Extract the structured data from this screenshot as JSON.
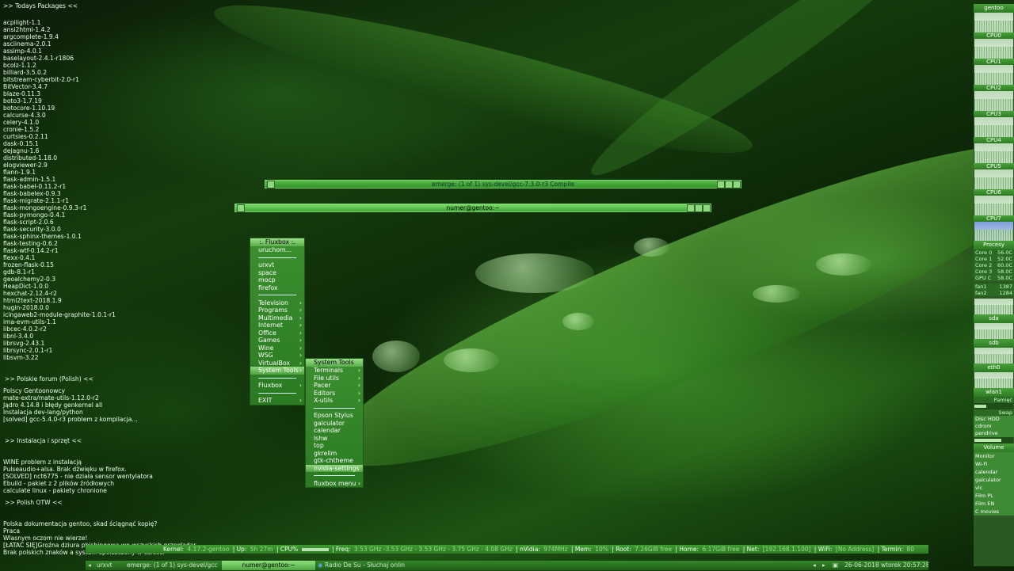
{
  "conky": {
    "packages_header": ">> Todays Packages <<",
    "packages": [
      "acpilight-1.1",
      "ansi2html-1.4.2",
      "argcomplete-1.9.4",
      "asciinema-2.0.1",
      "assimp-4.0.1",
      "baselayout-2.4.1-r1806",
      "bcolz-1.1.2",
      "billiard-3.5.0.2",
      "bitstream-cyberbit-2.0-r1",
      "BitVector-3.4.7",
      "blaze-0.11.3",
      "boto3-1.7.19",
      "botocore-1.10.19",
      "calcurse-4.3.0",
      "celery-4.1.0",
      "cronie-1.5.2",
      "curtsies-0.2.11",
      "dask-0.15.1",
      "dejagnu-1.6",
      "distributed-1.18.0",
      "elogviewer-2.9",
      "flann-1.9.1",
      "flask-admin-1.5.1",
      "flask-babel-0.11.2-r1",
      "flask-babelex-0.9.3",
      "flask-migrate-2.1.1-r1",
      "flask-mongoengine-0.9.3-r1",
      "flask-pymongo-0.4.1",
      "flask-script-2.0.6",
      "flask-security-3.0.0",
      "flask-sphinx-themes-1.0.1",
      "flask-testing-0.6.2",
      "flask-wtf-0.14.2-r1",
      "flexx-0.4.1",
      "frozen-flask-0.15",
      "gdb-8.1-r1",
      "geoalchemy2-0.3",
      "HeapDict-1.0.0",
      "hexchat-2.12.4-r2",
      "html2text-2018.1.9",
      "hugin-2018.0.0",
      "icingaweb2-module-graphite-1.0.1-r1",
      "ima-evm-utils-1.1",
      "libcec-4.0.2-r2",
      "libnl-3.4.0",
      "librsvg-2.43.1",
      "librsync-2.0.1-r1",
      "libsvm-3.22"
    ],
    "forum_header": ">> Polskie forum (Polish) <<",
    "forum": [
      "Polscy Gentoonowcy",
      "mate-extra/mate-utils-1.12.0-r2",
      "Jądro 4.14.8 i błędy genkernel all",
      "Instalacja dev-lang/python",
      "[solved] gcc-5.4.0-r3 problem z kompilacja..."
    ],
    "hw_header": ">> Instalacja i sprzęt <<",
    "hw": [
      "WINE problem z instalacją",
      "Pulseaudio+alsa. Brak dźwięku w firefox.",
      "[SOLVED] nct6775 - nie działa sensor wentylatora",
      "Ebuild - pakiet z 2 plików źródłowych",
      "calculate linux  - pakiety chronione"
    ],
    "otw_header": ">> Polish OTW <<",
    "otw": [
      "Polska dokumentacja gentoo, skad ściągnąć kopię?",
      "Praca",
      "Wlasnym oczom nie wierze!",
      "[ŁATAC SIĘ]Groźna dziura phishingowa we wszyskich przeglądar",
      "Brak polskich znaków a system spolszczony w całości"
    ]
  },
  "windows": {
    "emerge_title": "emerge: (1 of 1) sys-devel/gcc-7.3.0-r3 Compile",
    "terminal_title": "numer@gentoo:~"
  },
  "menu": {
    "title": ":. Fluxbox :.",
    "items": [
      {
        "label": "uruchom...",
        "sub": false
      },
      {
        "sep": true
      },
      {
        "label": "urxvt",
        "sub": false
      },
      {
        "label": "space",
        "sub": false
      },
      {
        "label": "mocp",
        "sub": false
      },
      {
        "label": "firefox",
        "sub": false
      },
      {
        "sep": true
      },
      {
        "label": "Television",
        "sub": true
      },
      {
        "label": "Programs",
        "sub": true
      },
      {
        "label": "Multimedia",
        "sub": true
      },
      {
        "label": "Internet",
        "sub": true
      },
      {
        "label": "Office",
        "sub": true
      },
      {
        "label": "Games",
        "sub": true
      },
      {
        "label": "Wine",
        "sub": true
      },
      {
        "label": "WSG",
        "sub": true
      },
      {
        "label": "VirtualBox",
        "sub": true
      },
      {
        "label": "System Tools",
        "sub": true,
        "active": true
      },
      {
        "sep": true
      },
      {
        "label": "Fluxbox",
        "sub": true
      },
      {
        "sep": true
      },
      {
        "label": "EXIT",
        "sub": true
      }
    ]
  },
  "submenu": {
    "title": "System Tools",
    "items": [
      {
        "label": "Terminals",
        "sub": true
      },
      {
        "label": "File utils",
        "sub": true
      },
      {
        "label": "Pacer",
        "sub": true
      },
      {
        "label": "Editors",
        "sub": true
      },
      {
        "label": "X-utils",
        "sub": true
      },
      {
        "sep": true
      },
      {
        "label": "Epson Stylus",
        "sub": false
      },
      {
        "label": "galculator",
        "sub": false
      },
      {
        "label": "calendar",
        "sub": false
      },
      {
        "label": "lshw",
        "sub": false
      },
      {
        "label": "top",
        "sub": false
      },
      {
        "label": "gkrellm",
        "sub": false
      },
      {
        "label": "gtk-chtheme",
        "sub": false
      },
      {
        "label": "nvidia-settings",
        "sub": false,
        "active": true
      },
      {
        "sep": true
      },
      {
        "label": "fluxbox menu",
        "sub": true
      }
    ]
  },
  "gkrellm": {
    "host": "gentoo",
    "cpus": [
      "CPU0",
      "CPU1",
      "CPU2",
      "CPU3",
      "CPU4",
      "CPU5",
      "CPU6",
      "CPU7"
    ],
    "procesy": "Procesy",
    "temps": [
      {
        "name": "Core 0",
        "value": "56.0C"
      },
      {
        "name": "Core 1",
        "value": "52.0C"
      },
      {
        "name": "Core 2",
        "value": "60.0C"
      },
      {
        "name": "Core 3",
        "value": "58.0C"
      },
      {
        "name": "GPU C",
        "value": "58.0C"
      }
    ],
    "fans": [
      {
        "name": "fan1",
        "value": "1387"
      },
      {
        "name": "fan2",
        "value": "1284"
      }
    ],
    "sda": "sda",
    "sdb": "sdb",
    "eth0": "eth0",
    "wlan1": "wlan1",
    "pamiec": "Pamięć",
    "swap": "Swap",
    "disc": "Disc HDD",
    "cdrom": "cdrom",
    "pendrive": "pendrive",
    "volume": "Volume",
    "launchers": [
      "Monitor",
      "Wi-Fi",
      "calendar",
      "galculator",
      "vlc",
      "Film PL",
      "Film EN",
      "C movies"
    ]
  },
  "status": {
    "kernel_label": "Kernel:",
    "kernel": "4.17.2-gentoo",
    "up_label": "| Up:",
    "up": "5h 27m",
    "cpu_label": "| CPU%",
    "freq_label": "| Freq:",
    "freq": "3.53 GHz -3.53 GHz - 3.53 GHz - 3.75 GHz - 4.08 GHz",
    "nvidia_label": "| nVidia:",
    "nvidia": "974MHz",
    "mem_label": "| Mem:",
    "mem": "10%",
    "root_label": "| Root:",
    "root": "7.26GiB free",
    "home_label": "| Home:",
    "home": "6.17GiB free",
    "net_label": "| Net:",
    "net": "[192.168.1.100]",
    "wifi_label": "| WiFi:",
    "wifi": "[No Address]",
    "term_label": "| Termin:",
    "term": "80"
  },
  "taskbar": {
    "prev": "◂",
    "next": "▸",
    "tasks": [
      "urxvt",
      "emerge: (1 of 1) sys-devel/gcc",
      "numer@gentoo:~",
      "Radio De Su - Słuchaj onlin"
    ],
    "datetime": "26-06-2018 wtorek 20:57:28"
  }
}
